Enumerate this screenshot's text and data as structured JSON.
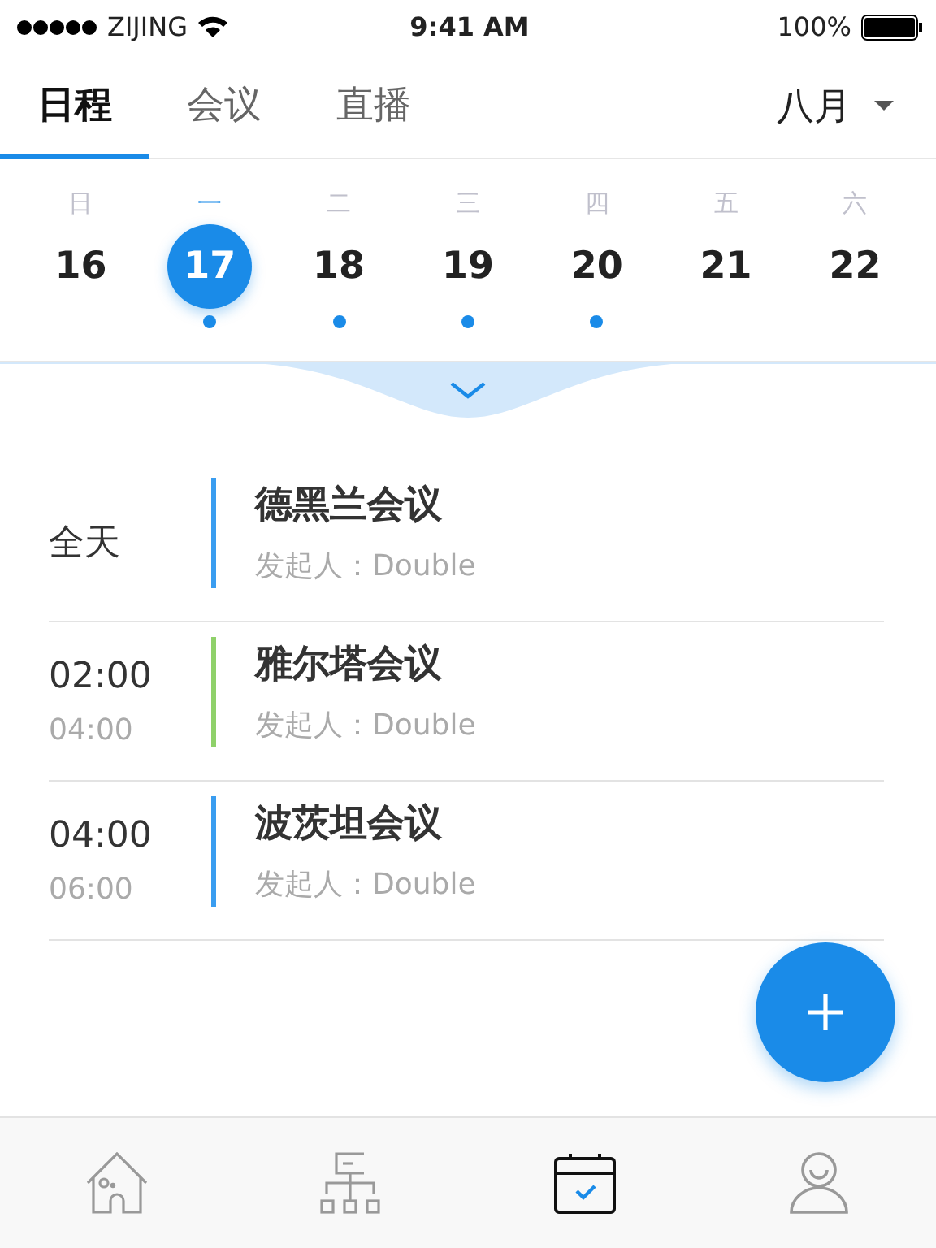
{
  "status_bar": {
    "carrier": "ZIJING",
    "time": "9:41 AM",
    "battery": "100%"
  },
  "tabs": [
    {
      "label": "日程",
      "selected": true
    },
    {
      "label": "会议",
      "selected": false
    },
    {
      "label": "直播",
      "selected": false
    }
  ],
  "month": "八月",
  "week": [
    {
      "weekday": "日",
      "date": "16",
      "selected": false,
      "has_event": false
    },
    {
      "weekday": "一",
      "date": "17",
      "selected": true,
      "has_event": true
    },
    {
      "weekday": "二",
      "date": "18",
      "selected": false,
      "has_event": true
    },
    {
      "weekday": "三",
      "date": "19",
      "selected": false,
      "has_event": true
    },
    {
      "weekday": "四",
      "date": "20",
      "selected": false,
      "has_event": true
    },
    {
      "weekday": "五",
      "date": "21",
      "selected": false,
      "has_event": false
    },
    {
      "weekday": "六",
      "date": "22",
      "selected": false,
      "has_event": false
    }
  ],
  "events": [
    {
      "start": "全天",
      "title": "德黑兰会议",
      "organizer": "发起人：Double",
      "color": "#3a9df0"
    },
    {
      "start": "02:00",
      "end": "04:00",
      "title": "雅尔塔会议",
      "organizer": "发起人：Double",
      "color": "#8fd16a"
    },
    {
      "start": "04:00",
      "end": "06:00",
      "title": "波茨坦会议",
      "organizer": "发起人：Double",
      "color": "#3a9df0"
    }
  ],
  "bottom_nav": [
    {
      "kind": "home",
      "selected": false
    },
    {
      "kind": "org",
      "selected": false
    },
    {
      "kind": "calendar",
      "selected": true
    },
    {
      "kind": "profile",
      "selected": false
    }
  ]
}
